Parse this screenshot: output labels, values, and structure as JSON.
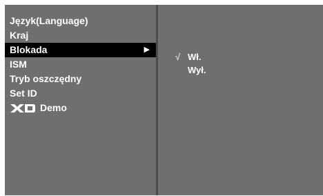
{
  "menu": {
    "items": [
      {
        "label": "Język(Language)"
      },
      {
        "label": "Kraj"
      },
      {
        "label": "Blokada",
        "selected": true,
        "icon": "right-arrow"
      },
      {
        "label": "ISM"
      },
      {
        "label": "Tryb oszczędny"
      },
      {
        "label": "Set ID"
      },
      {
        "label": "Demo",
        "logo": "XD"
      }
    ]
  },
  "submenu": {
    "options": [
      {
        "label": "Wł.",
        "checked": true,
        "check_glyph": "√"
      },
      {
        "label": "Wył.",
        "checked": false
      }
    ]
  },
  "colors": {
    "background": "#6f6f6f",
    "selected_row": "#000000",
    "divider": "#4c4c4c",
    "text": "#ffffff"
  }
}
